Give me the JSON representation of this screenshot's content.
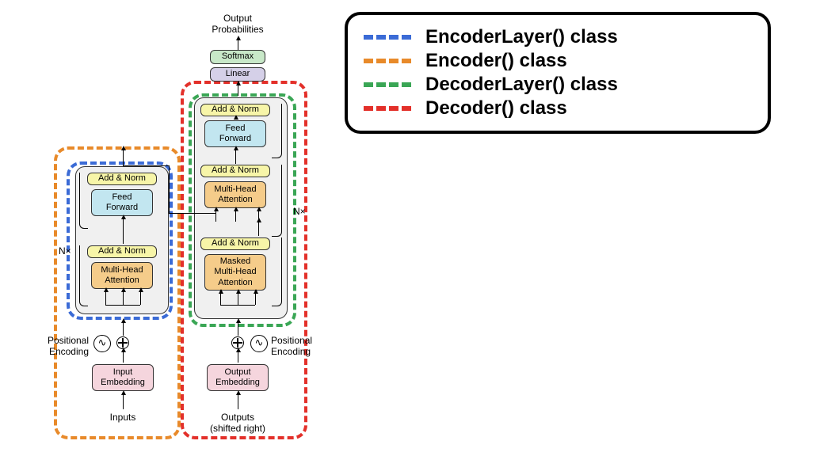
{
  "legend": {
    "items": [
      {
        "color": "#3b6bd6",
        "label": "EncoderLayer() class"
      },
      {
        "color": "#e88a2a",
        "label": "Encoder() class"
      },
      {
        "color": "#3aa655",
        "label": "DecoderLayer() class"
      },
      {
        "color": "#e3302a",
        "label": "Decoder() class"
      }
    ]
  },
  "diagram": {
    "output_probabilities": "Output\nProbabilities",
    "softmax": "Softmax",
    "linear": "Linear",
    "add_norm": "Add & Norm",
    "feed_forward": "Feed\nForward",
    "multi_head_attention": "Multi-Head\nAttention",
    "masked_multi_head_attention": "Masked\nMulti-Head\nAttention",
    "input_embedding": "Input\nEmbedding",
    "output_embedding": "Output\nEmbedding",
    "positional_encoding_left": "Positional\nEncoding",
    "positional_encoding_right": "Positional\nEncoding",
    "nx_left": "N×",
    "nx_right": "N×",
    "inputs": "Inputs",
    "outputs": "Outputs\n(shifted right)"
  }
}
